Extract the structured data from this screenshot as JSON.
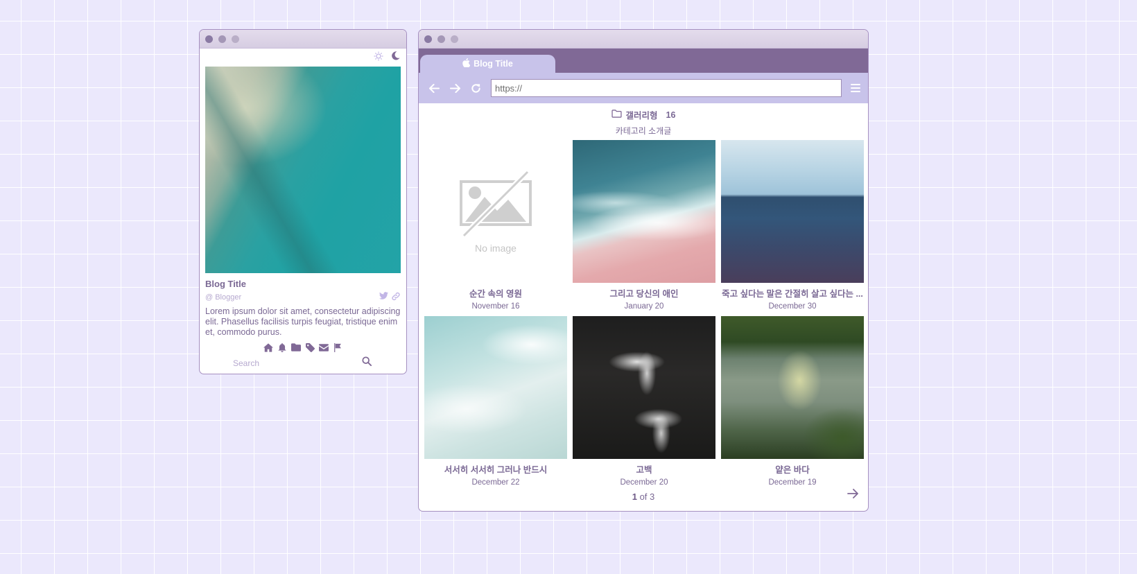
{
  "left": {
    "blog_title": "Blog Title",
    "blogger": "@ Blogger",
    "description": "Lorem ipsum dolor sit amet, consectetur adipiscing elit. Phasellus facilisis turpis feugiat, tristique enim et, commodo purus.",
    "search_placeholder": "Search",
    "icons": [
      "sun-icon",
      "moon-icon",
      "twitter-icon",
      "link-icon",
      "home-icon",
      "bell-icon",
      "folder-icon",
      "tag-icon",
      "mail-icon",
      "flag-icon",
      "search-icon"
    ]
  },
  "browser": {
    "tab_title": "Blog Title",
    "url": "https://",
    "icons": [
      "apple-icon",
      "back-arrow-icon",
      "forward-arrow-icon",
      "refresh-icon",
      "menu-icon"
    ]
  },
  "category": {
    "name": "갤러리형",
    "count": "16",
    "intro": "카테고리 소개글"
  },
  "posts": [
    {
      "title": "순간 속의 영원",
      "date": "November 16",
      "image": "No image"
    },
    {
      "title": "그리고 당신의 애인",
      "date": "January 20"
    },
    {
      "title": "죽고 싶다는 말은 간절히 살고 싶다는 ...",
      "date": "December 30"
    },
    {
      "title": "서서히 서서히 그러나 반드시",
      "date": "December 22"
    },
    {
      "title": "고백",
      "date": "December 20"
    },
    {
      "title": "얕은 바다",
      "date": "December 19"
    }
  ],
  "pager": {
    "current": "1",
    "of_text": "of 3"
  },
  "colors": {
    "accent": "#806996",
    "tab_bg": "#c8c3ea",
    "text": "#7a6894",
    "page_bg": "#ebe8fc"
  }
}
